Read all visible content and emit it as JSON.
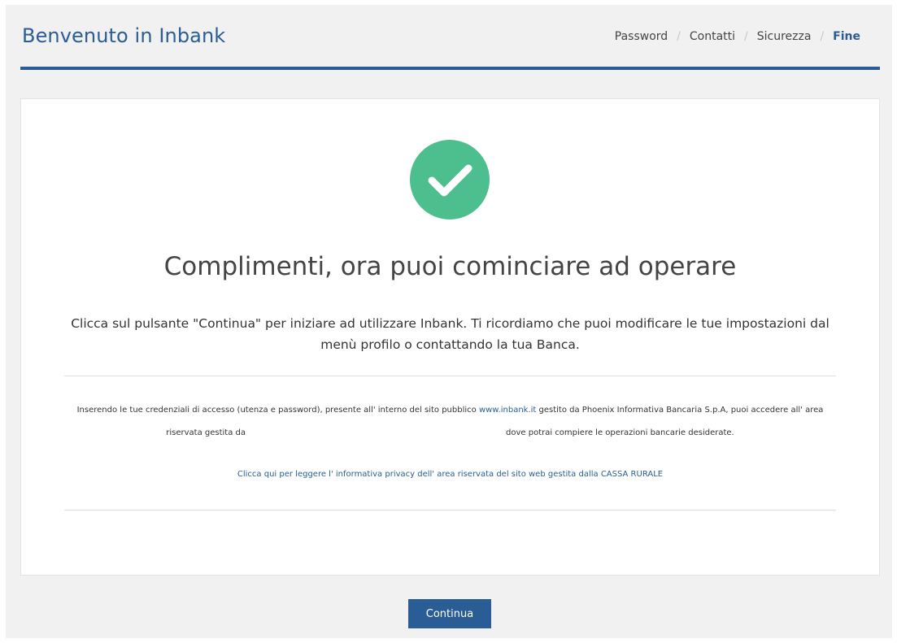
{
  "header": {
    "title": "Benvenuto in Inbank",
    "steps": [
      "Password",
      "Contatti",
      "Sicurezza",
      "Fine"
    ],
    "separator": "/"
  },
  "main": {
    "success_icon": "checkmark-icon",
    "headline": "Complimenti, ora puoi cominciare ad operare",
    "lead": "Clicca sul pulsante \"Continua\" per iniziare ad utilizzare Inbank. Ti ricordiamo che puoi modificare le tue impostazioni dal menù profilo o contattando la tua Banca.",
    "info_line1_before": "Inserendo le tue credenziali di accesso (utenza e password), presente all' interno del sito pubblico ",
    "info_link": "www.inbank.it",
    "info_line1_after": " gestito da Phoenix Informativa Bancaria S.p.A, puoi accedere all' area",
    "info_line2_left": "riservata gestita da",
    "info_line2_right": "dove potrai compiere le operazioni bancarie desiderate.",
    "privacy_link": "Clicca qui per leggere l' informativa privacy dell' area riservata del sito web gestita dalla CASSA RURALE"
  },
  "footer": {
    "continue_label": "Continua"
  },
  "colors": {
    "brand": "#2a5d95",
    "success": "#4dbe8e"
  }
}
